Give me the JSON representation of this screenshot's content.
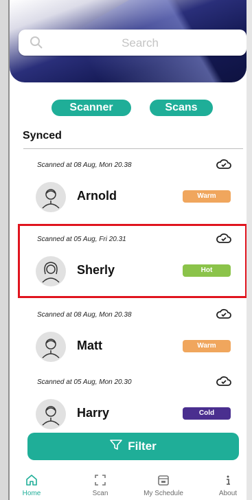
{
  "search": {
    "placeholder": "Search"
  },
  "buttons": {
    "scanner": "Scanner",
    "scans": "Scans"
  },
  "section": {
    "title": "Synced"
  },
  "records": [
    {
      "stamp": "Scanned at 08 Aug, Mon 20.38",
      "name": "Arnold",
      "status": "Warm",
      "status_color": "#f0a65d",
      "avatar": "male-avatar-icon"
    },
    {
      "stamp": "Scanned at 05 Aug, Fri 20.31",
      "name": "Sherly",
      "status": "Hot",
      "status_color": "#8bc34a",
      "avatar": "female-avatar-icon"
    },
    {
      "stamp": "Scanned at 08 Aug, Mon 20.38",
      "name": "Matt",
      "status": "Warm",
      "status_color": "#f0a65d",
      "avatar": "male-avatar-icon"
    },
    {
      "stamp": "Scanned at 05 Aug, Mon 20.30",
      "name": "Harry",
      "status": "Cold",
      "status_color": "#4a2f8f",
      "avatar": "male-avatar-icon"
    }
  ],
  "filter": {
    "label": "Filter"
  },
  "tabs": [
    {
      "label": "Home",
      "icon": "home-icon"
    },
    {
      "label": "Scan",
      "icon": "scan-icon"
    },
    {
      "label": "My Schedule",
      "icon": "calendar-icon"
    },
    {
      "label": "About",
      "icon": "info-icon"
    }
  ],
  "colors": {
    "accent": "#1fae98",
    "highlight": "#e0141e"
  }
}
